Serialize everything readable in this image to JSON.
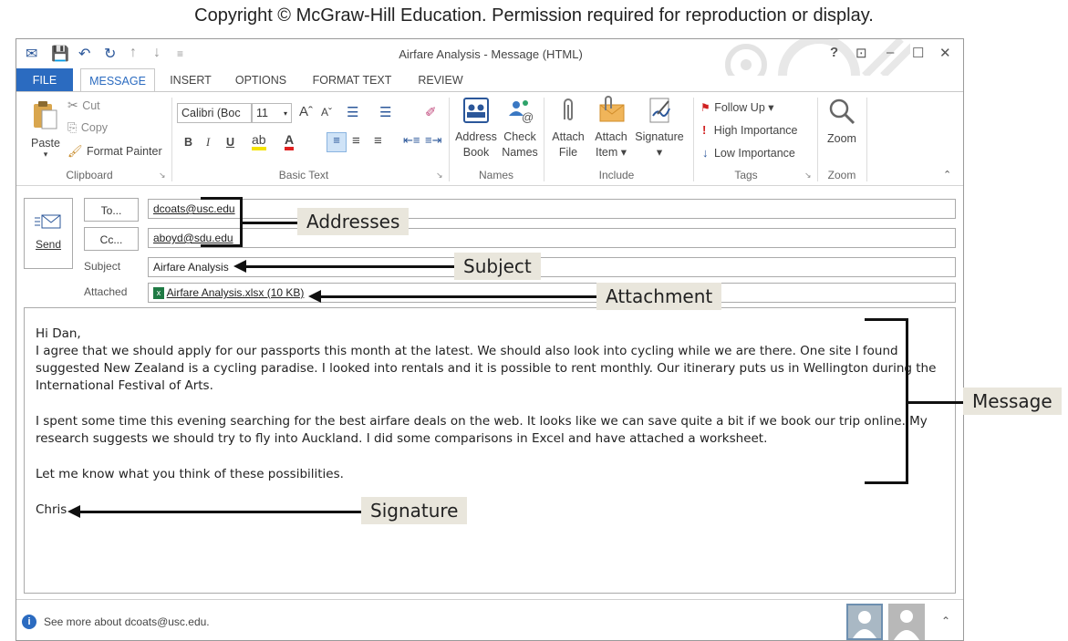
{
  "copyright": "Copyright © McGraw-Hill Education. Permission required for reproduction or display.",
  "window": {
    "title": "Airfare Analysis - Message (HTML)",
    "controls": {
      "help": "?",
      "restore": "⊡",
      "minimize": "–",
      "maximize": "☐",
      "close": "✕"
    }
  },
  "tabs": [
    {
      "label": "FILE"
    },
    {
      "label": "MESSAGE"
    },
    {
      "label": "INSERT"
    },
    {
      "label": "OPTIONS"
    },
    {
      "label": "FORMAT TEXT"
    },
    {
      "label": "REVIEW"
    }
  ],
  "ribbon": {
    "clipboard": {
      "paste": "Paste",
      "cut": "Cut",
      "copy": "Copy",
      "format_painter": "Format Painter",
      "label": "Clipboard"
    },
    "basic_text": {
      "font_name": "Calibri (Boc",
      "font_size": "11",
      "bold": "B",
      "italic": "I",
      "underline": "U",
      "label": "Basic Text"
    },
    "names": {
      "address_book_1": "Address",
      "address_book_2": "Book",
      "check_names_1": "Check",
      "check_names_2": "Names",
      "label": "Names"
    },
    "include": {
      "attach_file_1": "Attach",
      "attach_file_2": "File",
      "attach_item_1": "Attach",
      "attach_item_2": "Item ▾",
      "signature": "Signature",
      "signature_arrow": "▾",
      "label": "Include"
    },
    "tags": {
      "follow_up": "Follow Up ▾",
      "high_importance": "High Importance",
      "low_importance": "Low Importance",
      "label": "Tags"
    },
    "zoom": {
      "button": "Zoom",
      "label": "Zoom"
    }
  },
  "compose": {
    "send": "Send",
    "to_button": "To...",
    "cc_button": "Cc...",
    "to_value": "dcoats@usc.edu",
    "cc_value": "aboyd@sdu.edu",
    "subject_label": "Subject",
    "subject_value": "Airfare Analysis",
    "attached_label": "Attached",
    "attachment": "Airfare Analysis.xlsx (10 KB)"
  },
  "message": {
    "lines": [
      "Hi Dan,",
      "I agree that we should apply for our passports this month at the latest. We should also look into cycling while we are there. One site I found",
      "suggested New Zealand is a cycling paradise. I looked into rentals and it is possible to rent monthly. Our itinerary puts us in Wellington during the",
      "International Festival of Arts.",
      "I spent some time this evening searching for the best airfare deals on the web. It looks like we can save quite a bit if we book our trip online. My",
      "research suggests we should try to fly into Auckland. I did some comparisons in Excel and have attached a worksheet.",
      "Let me know what you think of these possibilities.",
      "Chris"
    ]
  },
  "status": {
    "info": "See more about dcoats@usc.edu."
  },
  "callouts": {
    "addresses": "Addresses",
    "subject": "Subject",
    "attachment": "Attachment",
    "message": "Message",
    "signature": "Signature"
  }
}
